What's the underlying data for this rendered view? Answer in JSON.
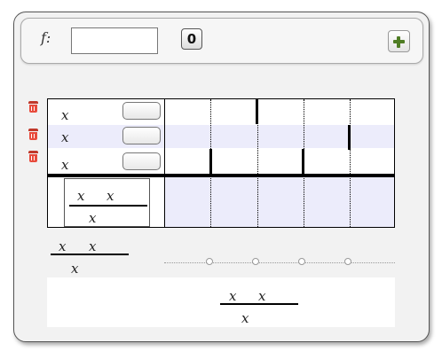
{
  "toolbar": {
    "f_label": "f:",
    "f_value": "",
    "zero_label": "0",
    "add_icon": "plus-icon"
  },
  "rows": [
    {
      "var": "x"
    },
    {
      "var": "x"
    },
    {
      "var": "x"
    }
  ],
  "expression": {
    "num1": "x",
    "num2": "x",
    "den": "x"
  },
  "summary": {
    "num1": "x",
    "num2": "x",
    "den": "x"
  },
  "result": {
    "num1": "x",
    "num2": "x",
    "den": "x"
  },
  "colors": {
    "band": "#ececfb",
    "trash": "#e84b3c",
    "add": "#4f7d24"
  }
}
